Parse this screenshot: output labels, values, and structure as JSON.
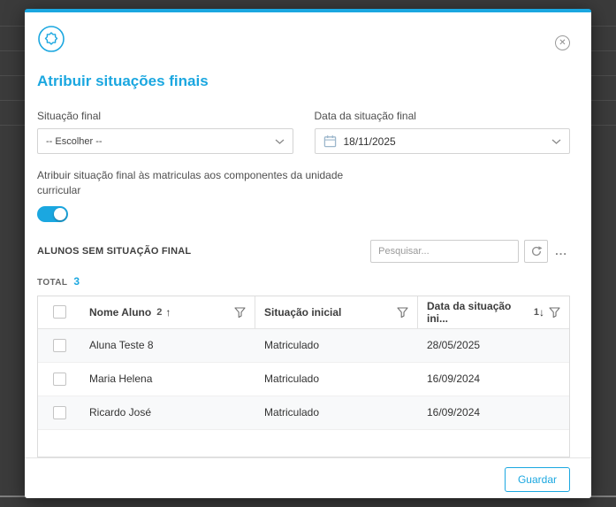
{
  "colors": {
    "accent": "#1ba7e0"
  },
  "modal": {
    "title": "Atribuir situações finais",
    "close_glyph": "✕",
    "fields": {
      "situacao": {
        "label": "Situação final",
        "value": "-- Escolher --"
      },
      "data": {
        "label": "Data da situação final",
        "value": "18/11/2025"
      }
    },
    "toggle_label": "Atribuir situação final às matriculas aos componentes da unidade curricular",
    "section_title": "ALUNOS SEM SITUAÇÃO FINAL",
    "search_placeholder": "Pesquisar...",
    "more_glyph": "...",
    "total_label": "TOTAL",
    "total_value": "3",
    "table": {
      "columns": [
        {
          "label": "Nome Aluno",
          "order": "2",
          "dir": "↑"
        },
        {
          "label": "Situação inicial",
          "order": "",
          "dir": ""
        },
        {
          "label": "Data da situação ini...",
          "order": "1",
          "dir": "↓"
        }
      ],
      "rows": [
        {
          "nome": "Aluna Teste 8",
          "situacao": "Matriculado",
          "data": "28/05/2025"
        },
        {
          "nome": "Maria Helena",
          "situacao": "Matriculado",
          "data": "16/09/2024"
        },
        {
          "nome": "Ricardo José",
          "situacao": "Matriculado",
          "data": "16/09/2024"
        }
      ]
    },
    "save_label": "Guardar"
  }
}
